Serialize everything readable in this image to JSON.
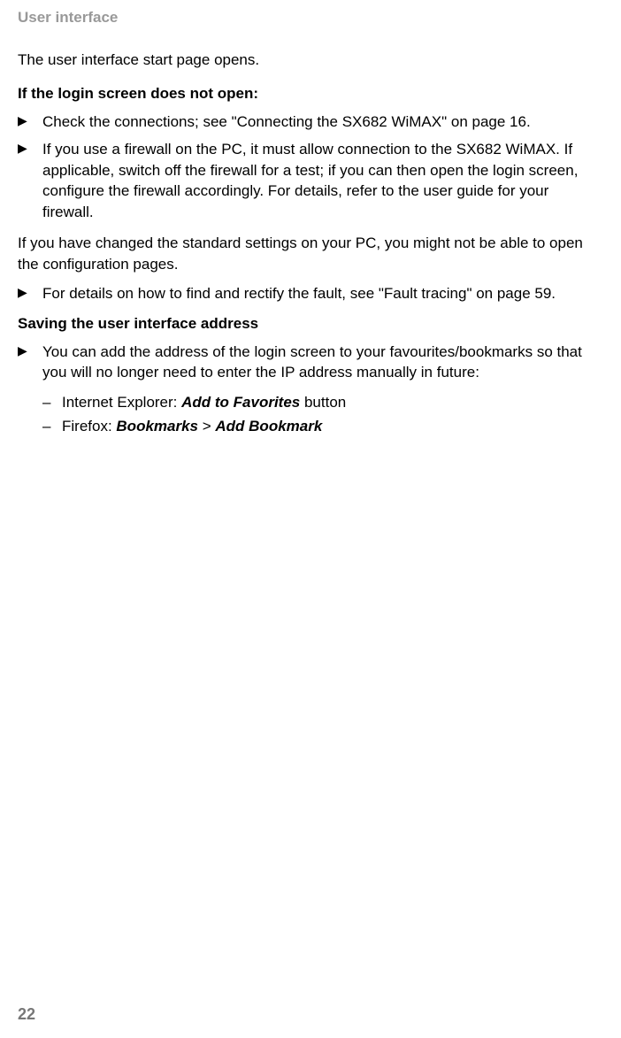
{
  "header": "User interface",
  "intro": "The user interface start page opens.",
  "section1": {
    "heading": "If the login screen does not open:",
    "bullets": [
      "Check the connections; see \"Connecting the SX682 WiMAX\" on page 16.",
      "If you use a firewall on the PC, it must allow connection to the SX682 WiMAX. If applicable, switch off the firewall for a test; if you can then open the login screen, configure the firewall accordingly. For details, refer to the user guide for your firewall."
    ]
  },
  "mid_para": "If you have changed the standard settings on your PC, you might not be able to open the configuration pages.",
  "section1b_bullets": [
    "For details on how to find and rectify the fault, see \"Fault tracing\" on page 59."
  ],
  "section2": {
    "heading": "Saving the user interface address",
    "bullets": [
      "You can add the address of the login screen to your favourites/bookmarks so that you will no longer need to enter the IP address manually in future:"
    ],
    "sub_ie_prefix": "Internet Explorer: ",
    "sub_ie_bold": "Add to Favorites",
    "sub_ie_suffix": " button",
    "sub_ff_prefix": "Firefox: ",
    "sub_ff_bold1": "Bookmarks",
    "sub_ff_sep": " > ",
    "sub_ff_bold2": "Add Bookmark"
  },
  "page_number": "22"
}
